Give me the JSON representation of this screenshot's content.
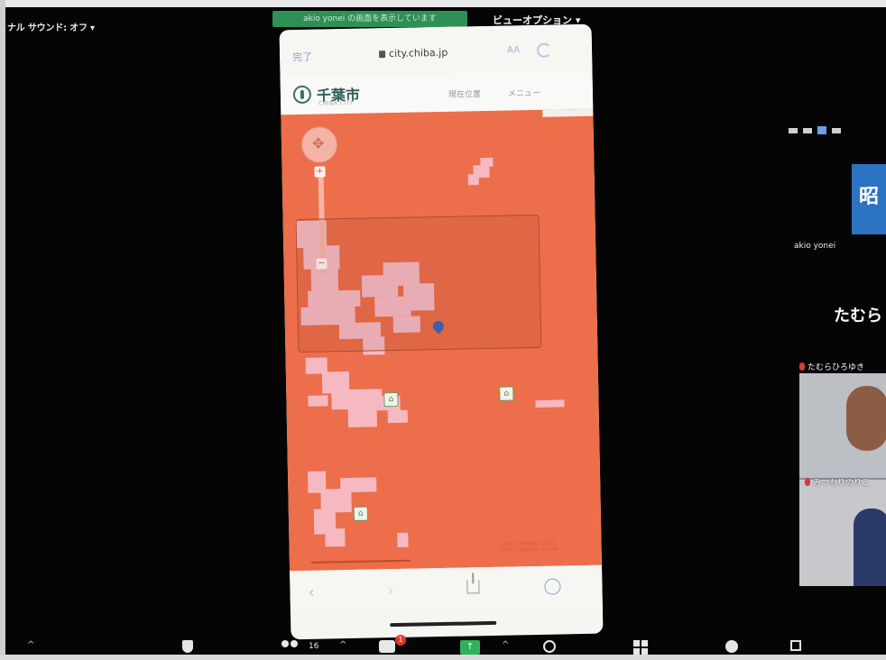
{
  "meeting": {
    "sound_label": "ナル サウンド: オフ ▾",
    "sharing_banner": "akio yonei の画面を表示しています",
    "view_options": "ビューオプション ▾"
  },
  "phone": {
    "safari": {
      "done": "完了",
      "url": "city.chiba.jp",
      "aa": "AA"
    },
    "site": {
      "logo": "千葉市",
      "logo_sub": "CHIBA CITY",
      "location_link": "現在位置",
      "menu_link": "メニュー"
    },
    "map": {
      "colors": {
        "hazard_area": "#ec6e4a",
        "light_area": "#f6b9c1",
        "pin": "#3e5fb4"
      },
      "copyright_lines": [
        "(c)2022 ZENRIN Co.,Ltd.",
        "(Z22LC 第0000号) 2022年"
      ]
    }
  },
  "gallery": {
    "host_tile_char": "昭",
    "host_name": "akio yonei",
    "featured_name": "たむら",
    "participant_2": "たむらひろゆき",
    "participant_3": "みつもりのりこ",
    "accent_color": "#2d73c4"
  },
  "toolbar": {
    "participant_count": "16",
    "chat_badge": "1",
    "share_label": "↑",
    "chevron": "^"
  }
}
